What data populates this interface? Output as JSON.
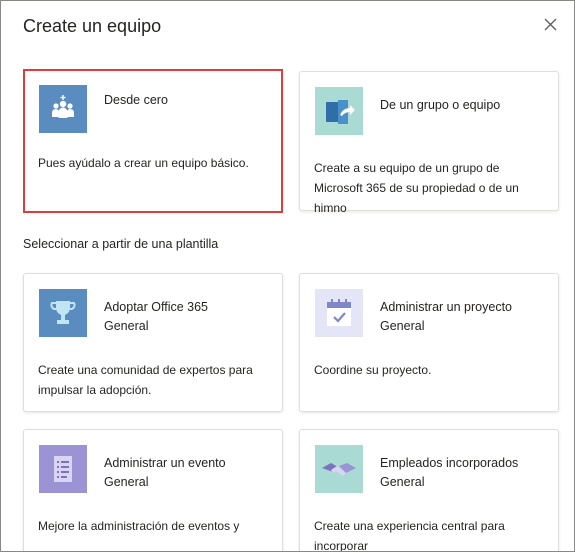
{
  "dialog": {
    "title": "Create un equipo",
    "close_icon": "close-icon"
  },
  "cards_top": [
    {
      "title": "Desde cero",
      "description": "Pues ayúdalo a crear un equipo básico.",
      "icon": "people-icon",
      "selected": true,
      "tile_color": "#5b8cc0"
    },
    {
      "title": "De un grupo o equipo",
      "description": "Create a su equipo de un grupo de Microsoft 365 de su propiedad o de un himno",
      "icon": "group-arrow-icon",
      "selected": false,
      "tile_color": "#a9dbd4"
    }
  ],
  "template_section": {
    "label": "Seleccionar a partir de una plantilla"
  },
  "templates": [
    {
      "title": "Adoptar Office 365",
      "subtitle": "General",
      "description": "Create una comunidad de expertos para impulsar la adopción.",
      "icon": "trophy-icon",
      "tile_color": "#5b8cc0"
    },
    {
      "title": "Administrar un proyecto",
      "subtitle": "General",
      "description": "Coordine su proyecto.",
      "icon": "calendar-check-icon",
      "tile_color": "#e4e6f7"
    },
    {
      "title": "Administrar un evento",
      "subtitle": "General",
      "description": "Mejore la administración de eventos y",
      "icon": "checklist-icon",
      "tile_color": "#9b93d3"
    },
    {
      "title": "Empleados incorporados",
      "subtitle": "General",
      "description": "Create una experiencia central para incorporar",
      "icon": "handshake-icon",
      "tile_color": "#a9dbd4"
    }
  ]
}
